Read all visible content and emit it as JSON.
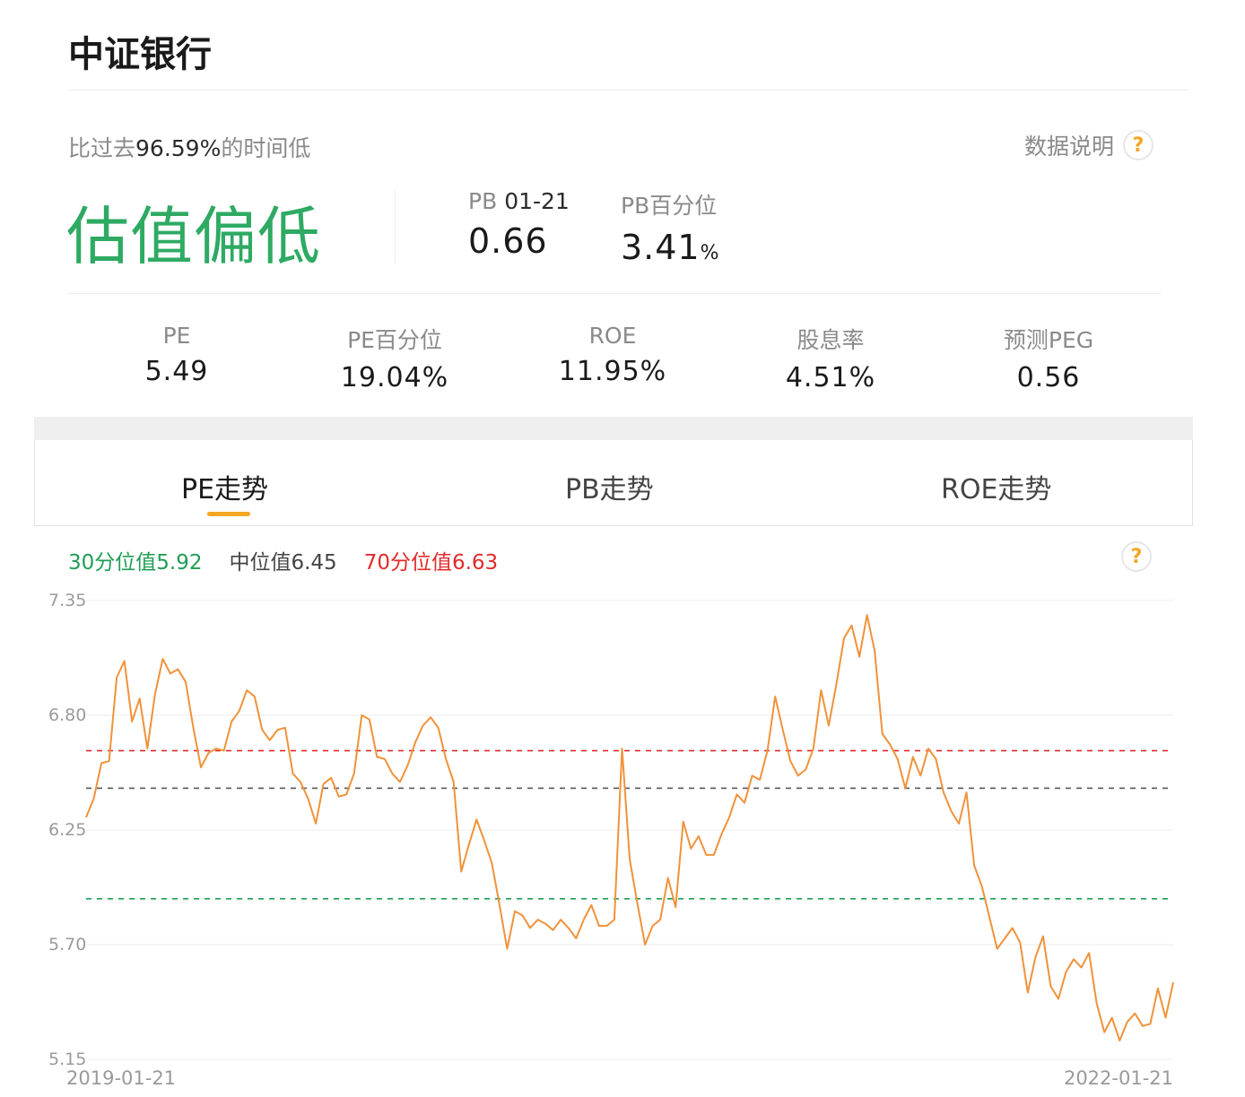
{
  "header": {
    "title": "中证银行"
  },
  "summary": {
    "compare_prefix": "比过去",
    "compare_value": "96.59%",
    "compare_suffix": "的时间低",
    "data_note": "数据说明",
    "help_symbol": "?",
    "verdict": "估值偏低"
  },
  "pb": {
    "label": "PB",
    "date": "01-21",
    "value": "0.66",
    "pct_label": "PB百分位",
    "pct_value": "3.41",
    "pct_unit": "%"
  },
  "metrics": [
    {
      "label": "PE",
      "value": "5.49"
    },
    {
      "label": "PE百分位",
      "value": "19.04%"
    },
    {
      "label": "ROE",
      "value": "11.95%"
    },
    {
      "label": "股息率",
      "value": "4.51%"
    },
    {
      "label": "预测PEG",
      "value": "0.56"
    }
  ],
  "tabs": [
    {
      "label": "PE走势",
      "active": true
    },
    {
      "label": "PB走势",
      "active": false
    },
    {
      "label": "ROE走势",
      "active": false
    }
  ],
  "legend": {
    "p30": "30分位值5.92",
    "median": "中位值6.45",
    "p70": "70分位值6.63"
  },
  "colors": {
    "accent": "#f5a623",
    "line": "#f0923a",
    "low": "#2eaa63",
    "p30": "#1f9d55",
    "median": "#555555",
    "p70": "#e02a2a"
  },
  "chart_data": {
    "type": "line",
    "y_ticks": [
      "7.35",
      "6.80",
      "6.25",
      "5.70",
      "5.15"
    ],
    "ylim": [
      5.15,
      7.35
    ],
    "x_start_label": "2019-01-21",
    "x_end_label": "2022-01-21",
    "x": [
      "2019-01-21",
      "2022-01-21"
    ],
    "reference_lines": {
      "p30": 5.92,
      "median": 6.45,
      "p70": 6.63
    },
    "series": [
      {
        "values": [
          6.31,
          6.4,
          6.57,
          6.58,
          6.98,
          7.06,
          6.77,
          6.88,
          6.64,
          6.9,
          7.07,
          7.0,
          7.02,
          6.96,
          6.74,
          6.55,
          6.62,
          6.64,
          6.63,
          6.77,
          6.82,
          6.92,
          6.89,
          6.73,
          6.68,
          6.73,
          6.74,
          6.52,
          6.48,
          6.4,
          6.28,
          6.47,
          6.5,
          6.41,
          6.42,
          6.52,
          6.8,
          6.78,
          6.6,
          6.59,
          6.52,
          6.48,
          6.56,
          6.67,
          6.75,
          6.79,
          6.74,
          6.59,
          6.48,
          6.05,
          6.18,
          6.3,
          6.2,
          6.09,
          5.89,
          5.68,
          5.86,
          5.84,
          5.78,
          5.82,
          5.8,
          5.77,
          5.82,
          5.78,
          5.73,
          5.82,
          5.89,
          5.79,
          5.79,
          5.82,
          6.64,
          6.11,
          5.9,
          5.7,
          5.79,
          5.82,
          6.02,
          5.88,
          6.29,
          6.16,
          6.22,
          6.13,
          6.13,
          6.23,
          6.31,
          6.42,
          6.38,
          6.51,
          6.49,
          6.63,
          6.89,
          6.73,
          6.58,
          6.51,
          6.54,
          6.64,
          6.92,
          6.75,
          6.95,
          7.17,
          7.23,
          7.08,
          7.28,
          7.11,
          6.71,
          6.66,
          6.59,
          6.45,
          6.6,
          6.51,
          6.64,
          6.59,
          6.43,
          6.34,
          6.28,
          6.43,
          6.08,
          5.98,
          5.83,
          5.68,
          5.73,
          5.78,
          5.71,
          5.47,
          5.64,
          5.74,
          5.5,
          5.44,
          5.57,
          5.63,
          5.59,
          5.66,
          5.42,
          5.28,
          5.35,
          5.24,
          5.33,
          5.37,
          5.31,
          5.32,
          5.49,
          5.35,
          5.52
        ]
      }
    ]
  }
}
